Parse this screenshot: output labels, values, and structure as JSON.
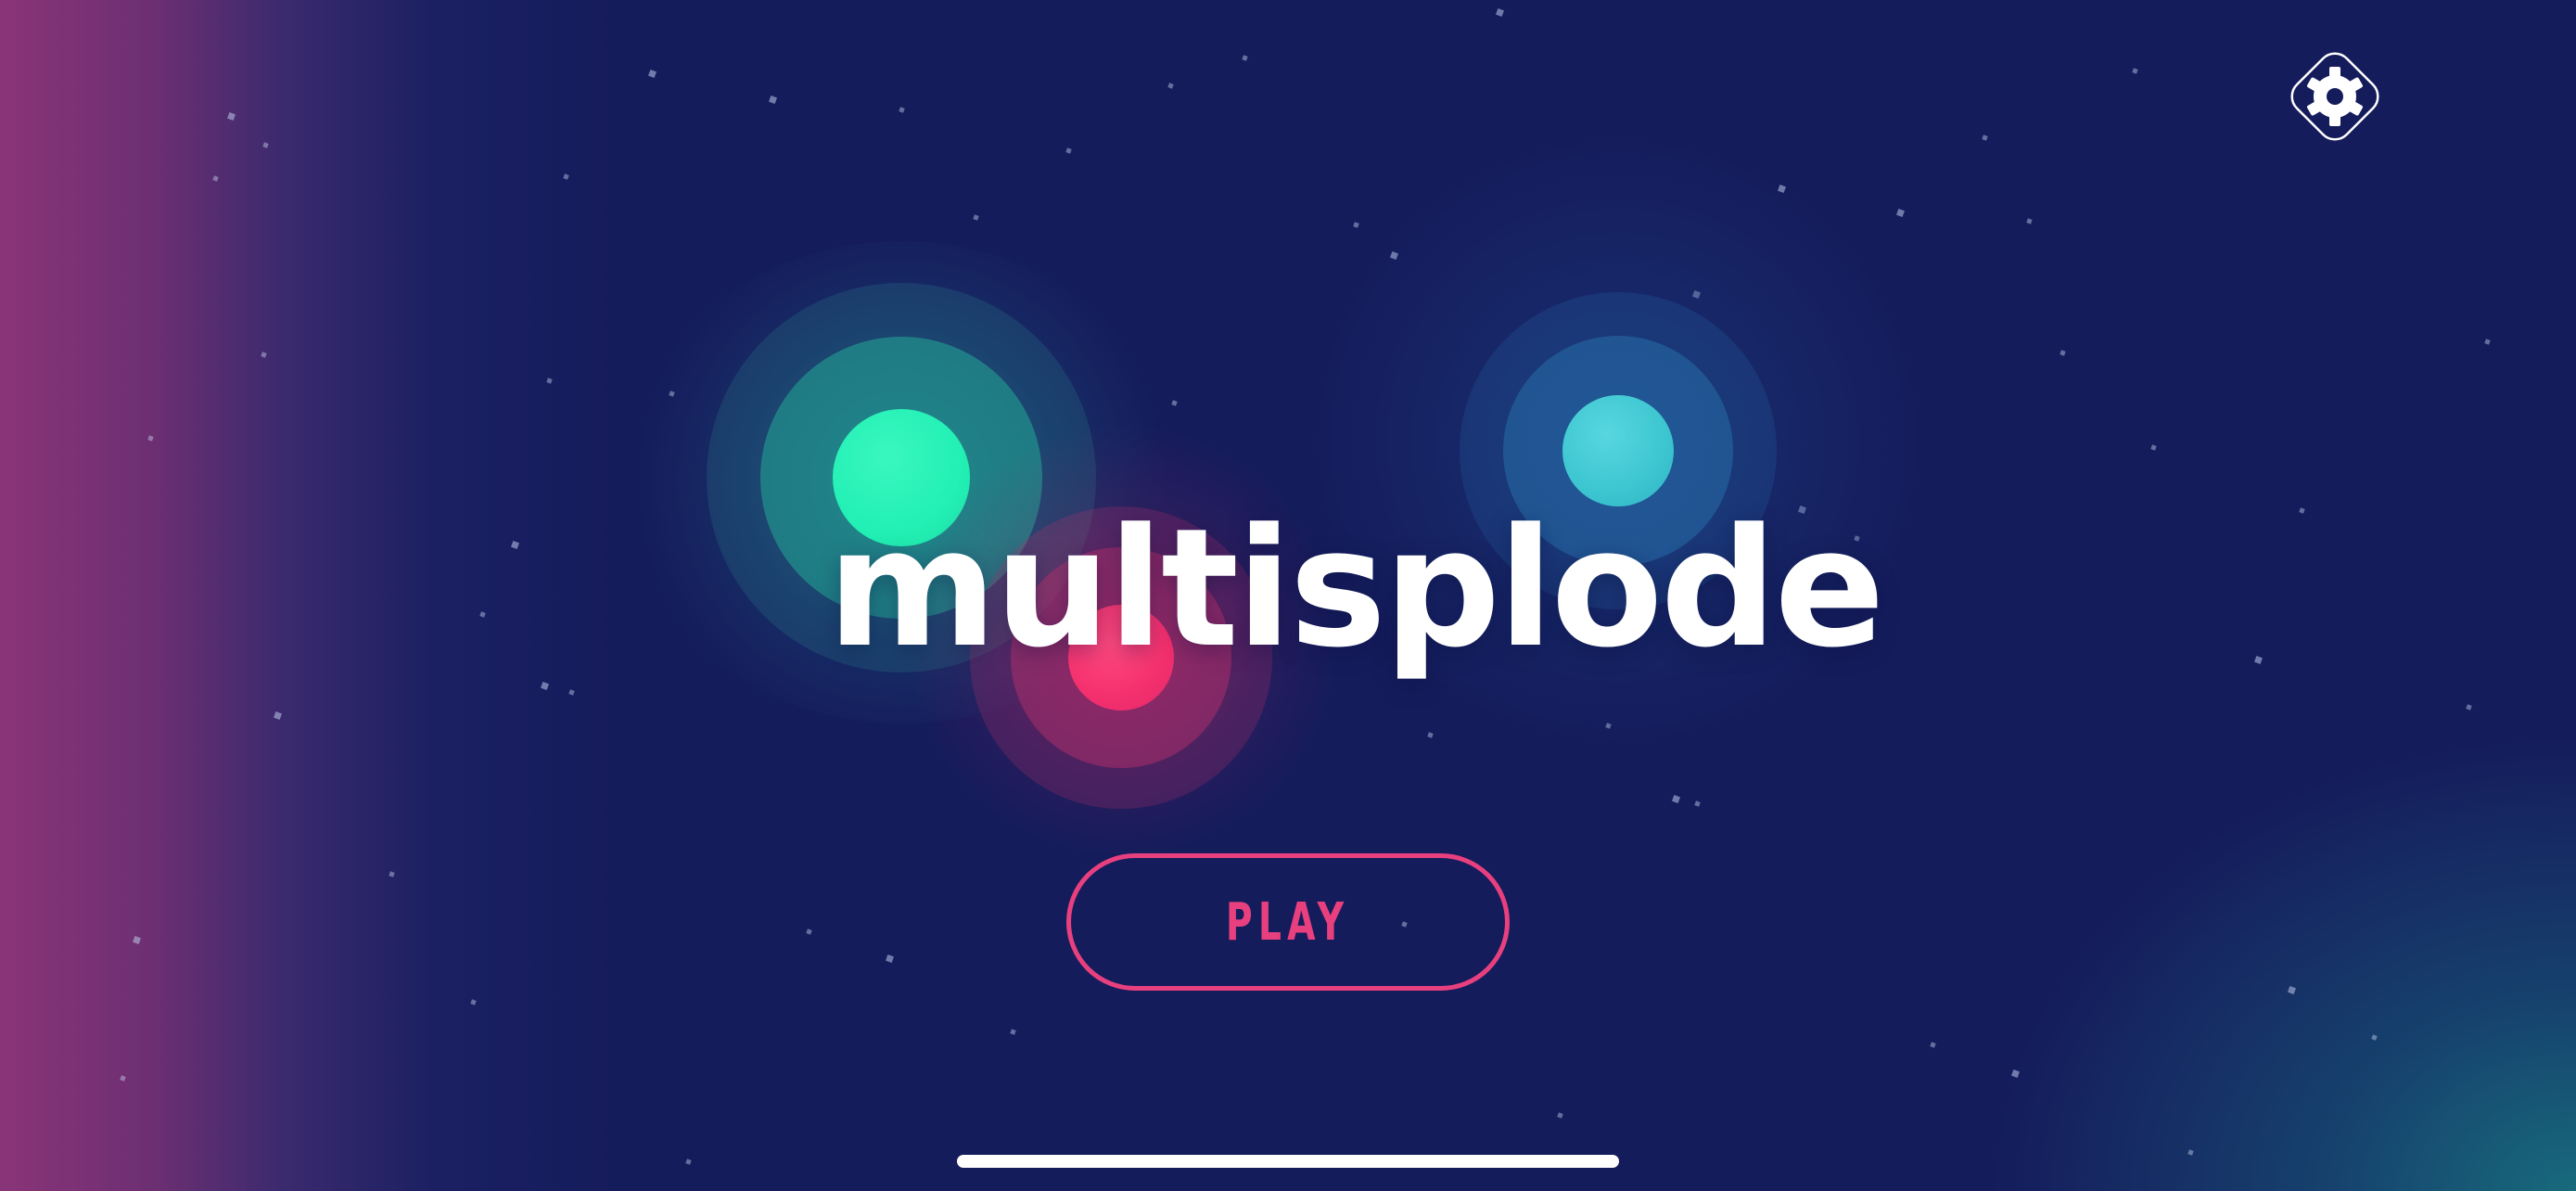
{
  "game": {
    "title": "multisplode"
  },
  "menu": {
    "play_label": "PLAY"
  },
  "icons": {
    "settings": "gear-icon"
  },
  "colors": {
    "background": "#151c5c",
    "accent_pink": "#e8407e",
    "orb_green": "#22f0b4",
    "orb_pink": "#f4306e",
    "orb_teal": "#3cc6d0"
  }
}
